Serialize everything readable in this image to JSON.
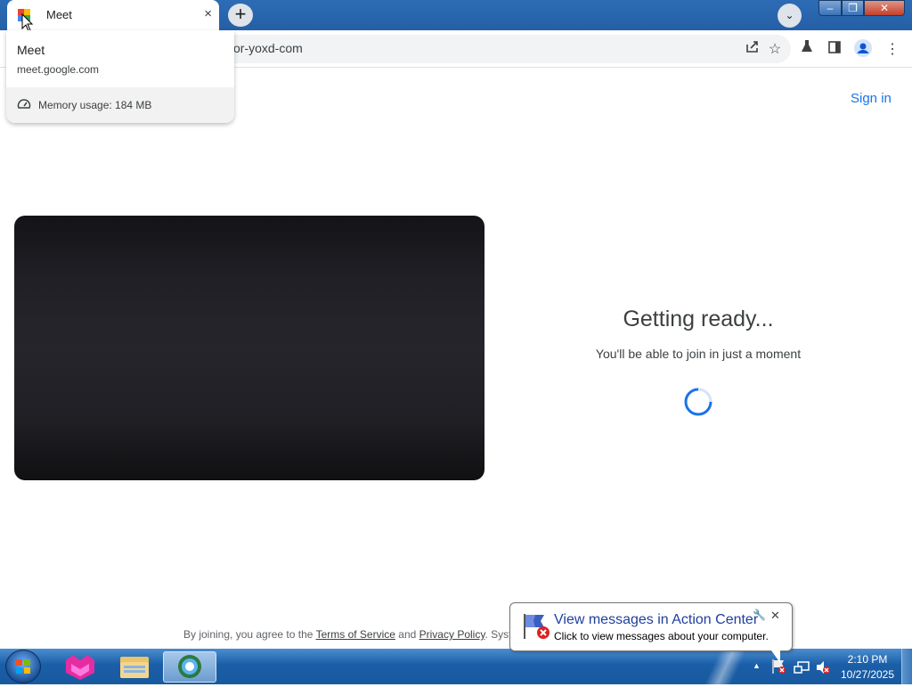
{
  "browser": {
    "tab_title": "Meet",
    "tab_close": "×",
    "new_tab": "+",
    "tab_search": "⌄",
    "url_visible": "or-yoxd-com",
    "window_controls": {
      "minimize": "–",
      "maximize": "❐",
      "close": "✕"
    },
    "hovercard": {
      "title": "Meet",
      "url": "meet.google.com",
      "memory": "Memory usage: 184 MB"
    }
  },
  "page": {
    "sign_in": "Sign in",
    "status_title": "Getting ready...",
    "status_subtitle": "You'll be able to join in just a moment",
    "footer": {
      "prefix": "By joining, you agree to the",
      "terms": "Terms of Service",
      "and": "and",
      "privacy": "Privacy Policy",
      "suffix": ". Syste"
    }
  },
  "notification": {
    "title": "View messages in Action Center",
    "subtitle": "Click to view messages about your computer.",
    "close": "✕"
  },
  "taskbar": {
    "time": "2:10 PM",
    "date": "10/27/2025"
  },
  "colors": {
    "accent": "#1a73e8",
    "titlebar": "#2d6cb5",
    "taskbar": "#1a5ea8"
  }
}
